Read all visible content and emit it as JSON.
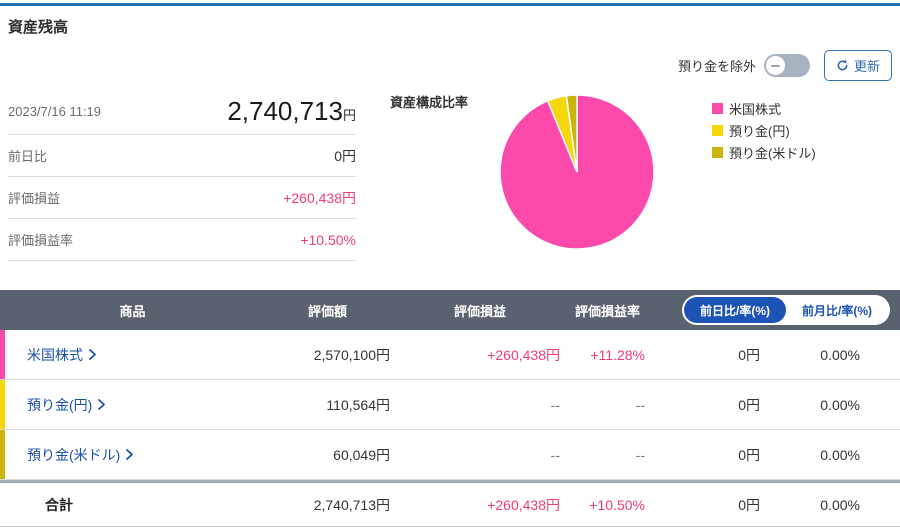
{
  "page": {
    "title": "資産残高"
  },
  "header_controls": {
    "exclude_toggle_label": "預り金を除外",
    "toggle_state": "off",
    "refresh_button_label": "更新"
  },
  "summary": {
    "as_of": "2023/7/16 11:19",
    "total_amount": "2,740,713",
    "currency_suffix": "円",
    "day_change_label": "前日比",
    "day_change_value": "0円",
    "pl_label": "評価損益",
    "pl_value": "+260,438円",
    "pl_rate_label": "評価損益率",
    "pl_rate_value": "+10.50%"
  },
  "chart_data": {
    "type": "pie",
    "title": "資産構成比率",
    "labels": [
      "米国株式",
      "預り金(円)",
      "預り金(米ドル)"
    ],
    "values": [
      93.8,
      4.0,
      2.2
    ],
    "unit": "%",
    "colors": [
      "#fb49ac",
      "#f5d70a",
      "#ccb40e"
    ],
    "legend_position": "right",
    "start_angle": "top",
    "direction": "clockwise"
  },
  "table": {
    "columns": [
      "商品",
      "評価額",
      "評価損益",
      "評価損益率"
    ],
    "period_toggle": {
      "selected": "前日比/率(%)",
      "unselected": "前月比/率(%)"
    },
    "rows": [
      {
        "name": "米国株式",
        "bar_color": "#fb49ac",
        "value": "2,570,100円",
        "pl": "+260,438円",
        "pl_rate": "+11.28%",
        "change": "0円",
        "change_rate": "0.00%"
      },
      {
        "name": "預り金(円)",
        "bar_color": "#f5d70a",
        "value": "110,564円",
        "pl": "--",
        "pl_rate": "--",
        "change": "0円",
        "change_rate": "0.00%"
      },
      {
        "name": "預り金(米ドル)",
        "bar_color": "#ccb40e",
        "value": "60,049円",
        "pl": "--",
        "pl_rate": "--",
        "change": "0円",
        "change_rate": "0.00%"
      }
    ],
    "total_row": {
      "name": "合計",
      "value": "2,740,713円",
      "pl": "+260,438円",
      "pl_rate": "+10.50%",
      "change": "0円",
      "change_rate": "0.00%"
    }
  },
  "colors": {
    "accent_pink": "#f03b78",
    "link_blue": "#1c51a8",
    "pill_blue": "#1d53b4",
    "table_header_bg": "#5a6270",
    "top_border_blue": "#1e73b8"
  }
}
